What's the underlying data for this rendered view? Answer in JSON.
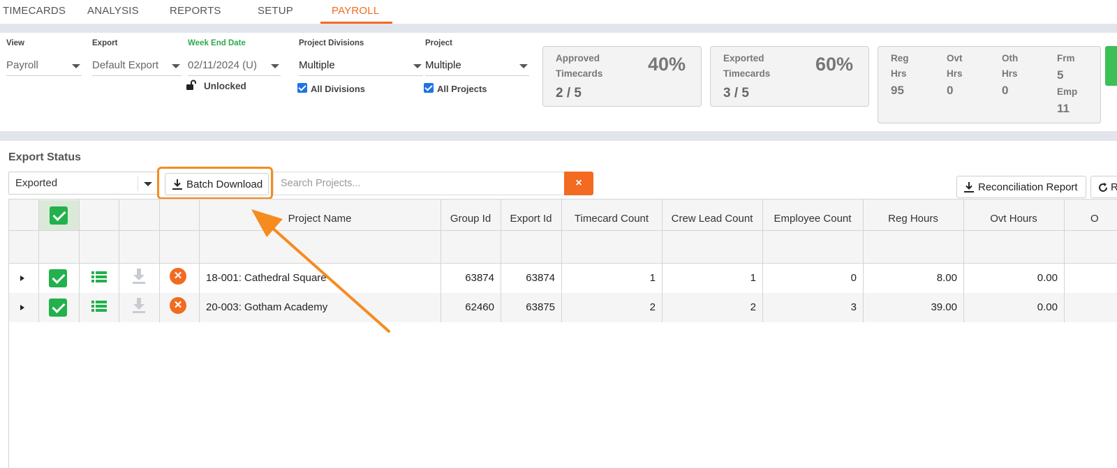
{
  "nav": {
    "tabs": [
      {
        "label": "TIMECARDS"
      },
      {
        "label": "ANALYSIS"
      },
      {
        "label": "REPORTS"
      },
      {
        "label": "SETUP"
      },
      {
        "label": "PAYROLL",
        "active": true
      }
    ]
  },
  "filters": {
    "view": {
      "label": "View",
      "value": "Payroll"
    },
    "export": {
      "label": "Export",
      "value": "Default Export"
    },
    "week_end": {
      "label": "Week End Date",
      "value": "02/11/2024 (U)",
      "lock_status": "Unlocked"
    },
    "divisions": {
      "label": "Project Divisions",
      "value": "Multiple",
      "checkbox_label": "All Divisions",
      "checked": true
    },
    "project": {
      "label": "Project",
      "value": "Multiple",
      "checkbox_label": "All Projects",
      "checked": true
    }
  },
  "stats": {
    "approved": {
      "line1": "Approved",
      "line2": "Timecards",
      "percent": "40%",
      "fraction": "2 / 5"
    },
    "exported": {
      "line1": "Exported",
      "line2": "Timecards",
      "percent": "60%",
      "fraction": "3 / 5"
    },
    "hours": {
      "reg": {
        "line1": "Reg",
        "line2": "Hrs",
        "value": "95"
      },
      "ovt": {
        "line1": "Ovt",
        "line2": "Hrs",
        "value": "0"
      },
      "oth": {
        "line1": "Oth",
        "line2": "Hrs",
        "value": "0"
      },
      "frm": {
        "label": "Frm",
        "value": "5"
      },
      "emp": {
        "label": "Emp",
        "value": "11"
      }
    }
  },
  "export_status": {
    "title": "Export Status",
    "status_value": "Exported",
    "batch_download_label": "Batch Download",
    "search_placeholder": "Search Projects...",
    "clear_label": "×",
    "reconciliation_label": "Reconciliation Report",
    "refresh_partial_label": "R"
  },
  "grid": {
    "headers": [
      "Project Name",
      "Group Id",
      "Export Id",
      "Timecard Count",
      "Crew Lead Count",
      "Employee Count",
      "Reg Hours",
      "Ovt Hours",
      "O"
    ],
    "rows": [
      {
        "project": "18-001: Cathedral Square",
        "group_id": "63874",
        "export_id": "63874",
        "timecards": "1",
        "crew_leads": "1",
        "employees": "0",
        "reg_hours": "8.00",
        "ovt_hours": "0.00"
      },
      {
        "project": "20-003: Gotham Academy",
        "group_id": "62460",
        "export_id": "63875",
        "timecards": "2",
        "crew_leads": "2",
        "employees": "3",
        "reg_hours": "39.00",
        "ovt_hours": "0.00"
      }
    ]
  },
  "colors": {
    "accent": "#f26b21",
    "success": "#22b14c",
    "highlight": "#f68b1f"
  },
  "icons": [
    "download-icon",
    "list-icon",
    "cancel-icon",
    "refresh-icon",
    "lock-open-icon",
    "expand-icon"
  ]
}
